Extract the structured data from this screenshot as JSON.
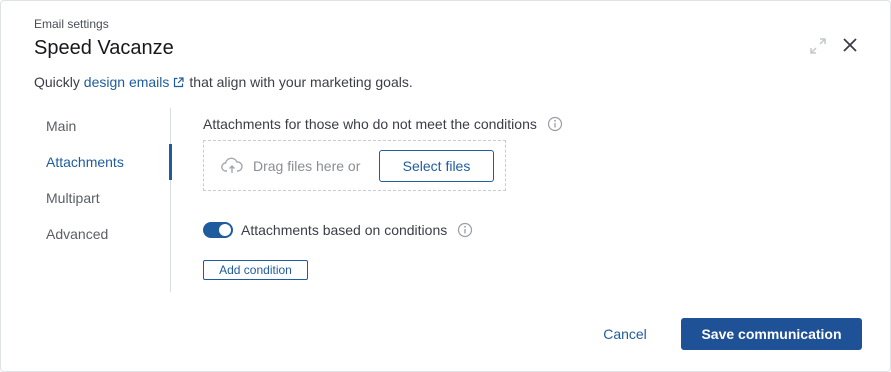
{
  "header": {
    "eyebrow": "Email settings",
    "title": "Speed Vacanze",
    "expand_icon": "expand-icon",
    "close_icon": "close-icon"
  },
  "subtitle": {
    "prefix": "Quickly",
    "link": "design emails",
    "suffix": "that align with your marketing goals."
  },
  "nav": {
    "items": [
      {
        "label": "Main"
      },
      {
        "label": "Attachments"
      },
      {
        "label": "Multipart"
      },
      {
        "label": "Advanced"
      }
    ],
    "active": "Attachments"
  },
  "attachments": {
    "section_label": "Attachments for those who do not meet the conditions",
    "drop_text": "Drag files here or",
    "select_files": "Select files",
    "toggle_label": "Attachments based on conditions",
    "toggle_on": true,
    "add_condition": "Add condition"
  },
  "footer": {
    "cancel": "Cancel",
    "save": "Save communication"
  },
  "colors": {
    "accent": "#1f5c9e",
    "primary_button": "#1f5196"
  }
}
